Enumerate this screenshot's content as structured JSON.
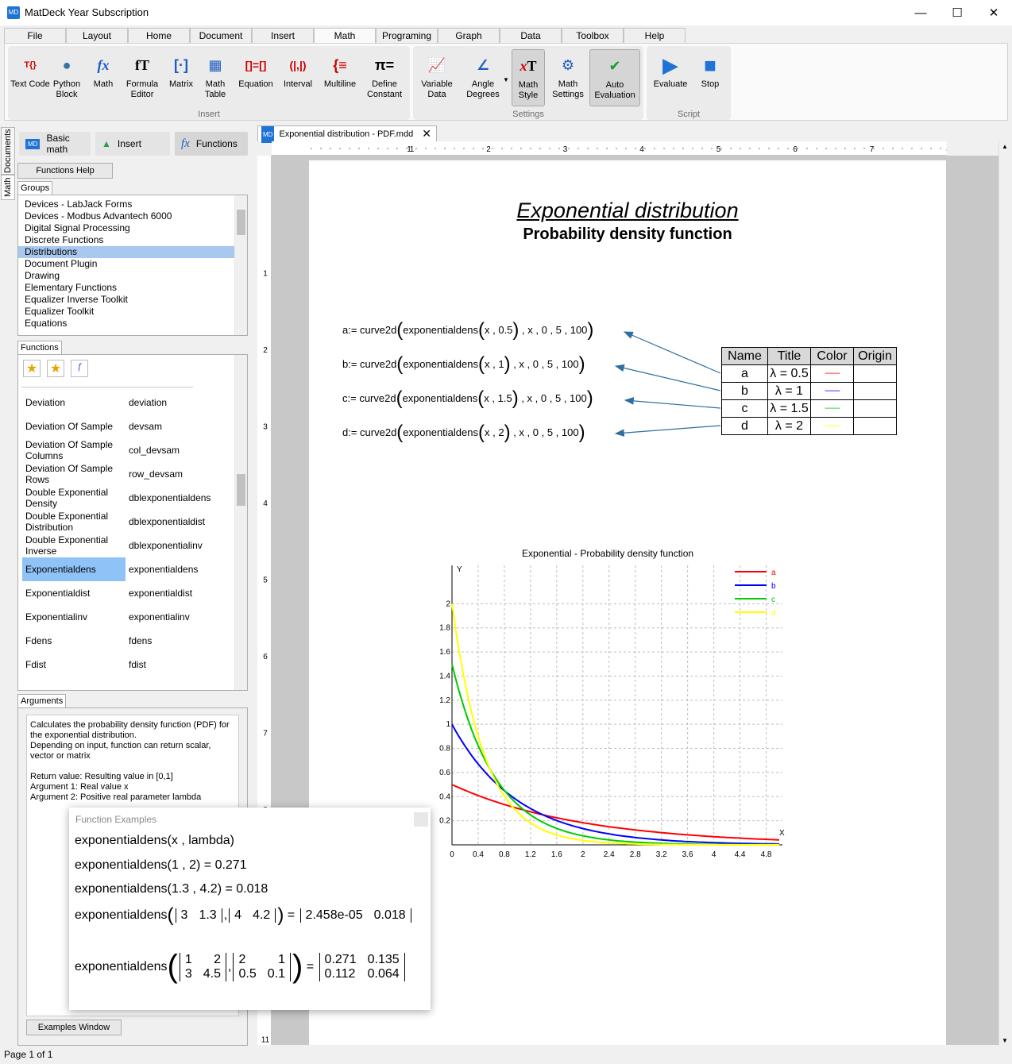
{
  "window": {
    "title": "MatDeck Year Subscription",
    "app_icon": "MD"
  },
  "menu_tabs": [
    "File",
    "Layout",
    "Home",
    "Document",
    "Insert",
    "Math",
    "Programing",
    "Graph",
    "Data",
    "Toolbox",
    "Help"
  ],
  "ribbon": {
    "insert": [
      "Text Code",
      "Python Block",
      "Math",
      "Formula Editor",
      "Matrix",
      "Math Table",
      "Equation",
      "Interval",
      "Multiline",
      "Define Constant"
    ],
    "insert_label": "Insert",
    "settings": [
      "Variable Data",
      "Angle Degrees",
      "Math Style",
      "Math Settings",
      "Auto Evaluation"
    ],
    "settings_label": "Settings",
    "script": [
      "Evaluate",
      "Stop"
    ],
    "script_label": "Script"
  },
  "side_tabs": [
    "Documents",
    "Math"
  ],
  "left_panel": {
    "top_buttons": [
      "Basic math",
      "Insert",
      "Functions"
    ],
    "functions_help": "Functions Help",
    "groups_tab": "Groups",
    "groups": [
      "Devices - LabJack Forms",
      "Devices - Modbus Advantech 6000",
      "Digital Signal Processing",
      "Discrete Functions",
      "Distributions",
      "Document Plugin",
      "Drawing",
      "Elementary Functions",
      "Equalizer Inverse Toolkit",
      "Equalizer Toolkit",
      "Equations"
    ],
    "groups_selected": "Distributions",
    "functions_tab": "Functions",
    "functions": [
      {
        "name": "Deviation",
        "code": "deviation"
      },
      {
        "name": "Deviation Of Sample",
        "code": "devsam"
      },
      {
        "name": "Deviation Of Sample Columns",
        "code": "col_devsam"
      },
      {
        "name": "Deviation Of Sample Rows",
        "code": "row_devsam"
      },
      {
        "name": "Double Exponential Density",
        "code": "dblexponentialdens"
      },
      {
        "name": "Double Exponential Distribution",
        "code": "dblexponentialdist"
      },
      {
        "name": "Double Exponential Inverse",
        "code": "dblexponentialinv"
      },
      {
        "name": "Exponentialdens",
        "code": "exponentialdens"
      },
      {
        "name": "Exponentialdist",
        "code": "exponentialdist"
      },
      {
        "name": "Exponentialinv",
        "code": "exponentialinv"
      },
      {
        "name": "Fdens",
        "code": "fdens"
      },
      {
        "name": "Fdist",
        "code": "fdist"
      }
    ],
    "functions_selected": "Exponentialdens",
    "arguments_tab": "Arguments",
    "arguments_text": "Calculates the probability density function (PDF) for the exponential distribution.\nDepending on input, function can return scalar, vector or matrix\n\nReturn value: Resulting value in [0,1]\nArgument 1: Real value x\nArgument 2: Positive real parameter lambda",
    "examples_window_button": "Examples Window"
  },
  "document": {
    "tab_title": "Exponential distribution - PDF.mdd",
    "title": "Exponential distribution",
    "subtitle": "Probability density function",
    "definitions": [
      {
        "var": "a",
        "lambda": "0.5",
        "code": "a:= curve2d(exponentialdens(x , 0.5) , x , 0 , 5 , 100)"
      },
      {
        "var": "b",
        "lambda": "1",
        "code": "b:= curve2d(exponentialdens(x , 1) , x , 0 , 5 , 100)"
      },
      {
        "var": "c",
        "lambda": "1.5",
        "code": "c:= curve2d(exponentialdens(x , 1.5) , x , 0 , 5 , 100)"
      },
      {
        "var": "d",
        "lambda": "2",
        "code": "d:= curve2d(exponentialdens(x , 2) , x , 0 , 5 , 100)"
      }
    ],
    "plot_table": {
      "headers": [
        "Name",
        "Title",
        "Color",
        "Origin"
      ],
      "rows": [
        {
          "name": "a",
          "title": "λ = 0.5",
          "color": "#ff0000",
          "dash": "--------"
        },
        {
          "name": "b",
          "title": "λ = 1",
          "color": "#0000ff",
          "dash": "--------"
        },
        {
          "name": "c",
          "title": "λ = 1.5",
          "color": "#00cc00",
          "dash": "--------"
        },
        {
          "name": "d",
          "title": "λ = 2",
          "color": "#ffff00",
          "dash": "--------"
        }
      ]
    }
  },
  "chart_data": {
    "type": "line",
    "title": "Exponential - Probability density function",
    "xlabel": "X",
    "ylabel": "Y",
    "xlim": [
      0,
      5
    ],
    "ylim": [
      0,
      2.2
    ],
    "x_ticks": [
      0,
      0.4,
      0.8,
      1.2,
      1.6,
      2,
      2.4,
      2.8,
      3.2,
      3.6,
      4,
      4.4,
      4.8
    ],
    "y_ticks": [
      0.2,
      0.4,
      0.6,
      0.8,
      1,
      1.2,
      1.4,
      1.6,
      1.8,
      2
    ],
    "grid": true,
    "legend": "top-right",
    "series": [
      {
        "name": "a",
        "lambda": 0.5,
        "color": "#ff0000",
        "x": [
          0,
          0.5,
          1,
          1.5,
          2,
          2.5,
          3,
          3.5,
          4,
          4.5,
          5
        ],
        "values": [
          0.5,
          0.389,
          0.303,
          0.236,
          0.184,
          0.143,
          0.112,
          0.087,
          0.068,
          0.053,
          0.041
        ]
      },
      {
        "name": "b",
        "lambda": 1,
        "color": "#0000ff",
        "x": [
          0,
          0.5,
          1,
          1.5,
          2,
          2.5,
          3,
          3.5,
          4,
          4.5,
          5
        ],
        "values": [
          1,
          0.607,
          0.368,
          0.223,
          0.135,
          0.082,
          0.05,
          0.03,
          0.018,
          0.011,
          0.007
        ]
      },
      {
        "name": "c",
        "lambda": 1.5,
        "color": "#00cc00",
        "x": [
          0,
          0.5,
          1,
          1.5,
          2,
          2.5,
          3,
          3.5,
          4,
          4.5,
          5
        ],
        "values": [
          1.5,
          0.708,
          0.335,
          0.158,
          0.075,
          0.035,
          0.017,
          0.008,
          0.004,
          0.002,
          0.001
        ]
      },
      {
        "name": "d",
        "lambda": 2,
        "color": "#ffff00",
        "x": [
          0,
          0.5,
          1,
          1.5,
          2,
          2.5,
          3,
          3.5,
          4,
          4.5,
          5
        ],
        "values": [
          2,
          0.736,
          0.271,
          0.1,
          0.037,
          0.013,
          0.005,
          0.002,
          0.001,
          0,
          0
        ]
      }
    ]
  },
  "examples": {
    "title": "Function Examples",
    "lines": [
      "exponentialdens(x , lambda)",
      "exponentialdens(1 , 2) = 0.271",
      "exponentialdens(1.3 , 4.2) = 0.018"
    ],
    "vec_example": {
      "fn": "exponentialdens",
      "a": [
        "3",
        "1.3"
      ],
      "b": [
        "4",
        "4.2"
      ],
      "result": [
        "2.458e-05",
        "0.018"
      ]
    },
    "mat_example": {
      "fn": "exponentialdens",
      "a": [
        [
          "1",
          "2"
        ],
        [
          "3",
          "4.5"
        ]
      ],
      "b": [
        [
          "2",
          "1"
        ],
        [
          "0.5",
          "0.1"
        ]
      ],
      "result": [
        [
          "0.271",
          "0.135"
        ],
        [
          "0.112",
          "0.064"
        ]
      ]
    }
  },
  "status": {
    "page": "Page 1 of 1"
  }
}
